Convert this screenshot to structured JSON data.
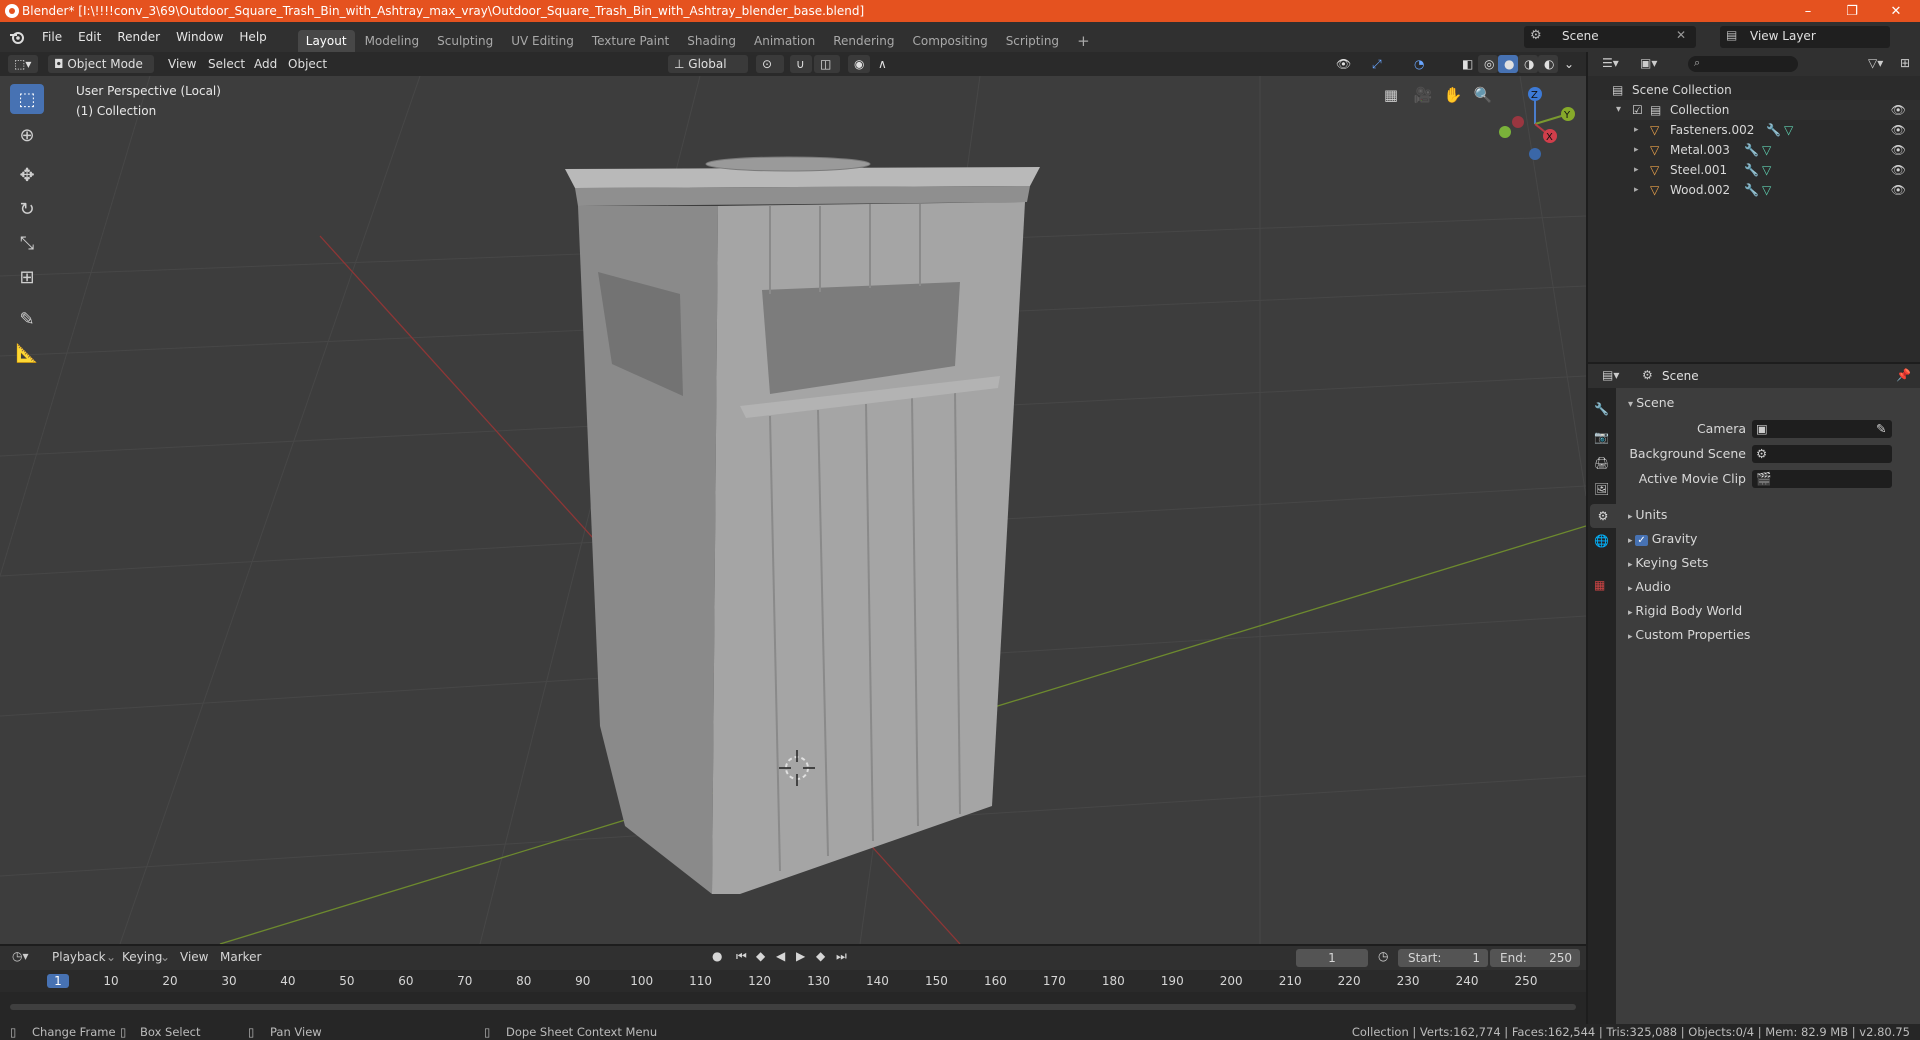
{
  "window": {
    "title": "Blender* [I:\\!!!!conv_3\\69\\Outdoor_Square_Trash_Bin_with_Ashtray_max_vray\\Outdoor_Square_Trash_Bin_with_Ashtray_blender_base.blend]",
    "minimize": "–",
    "maximize": "❐",
    "close": "✕",
    "accent": "#e5521f"
  },
  "menu": {
    "file": "File",
    "edit": "Edit",
    "render": "Render",
    "window": "Window",
    "help": "Help"
  },
  "workspaces": [
    "Layout",
    "Modeling",
    "Sculpting",
    "UV Editing",
    "Texture Paint",
    "Shading",
    "Animation",
    "Rendering",
    "Compositing",
    "Scripting"
  ],
  "workspace_add": "+",
  "scene_field": "Scene",
  "view_layer_field": "View Layer",
  "viewport_header": {
    "mode": "Object Mode",
    "view": "View",
    "select": "Select",
    "add": "Add",
    "object": "Object",
    "orientation": "Global"
  },
  "viewport": {
    "perspective": "User Perspective (Local)",
    "collection": "(1) Collection",
    "gizmo": {
      "x": "X",
      "y": "Y",
      "z": "Z"
    }
  },
  "outliner": {
    "root": "Scene Collection",
    "collection": "Collection",
    "objects": [
      "Fasteners.002",
      "Metal.003",
      "Steel.001",
      "Wood.002"
    ]
  },
  "properties": {
    "context": "Scene",
    "section": "Scene",
    "camera_label": "Camera",
    "background_label": "Background Scene",
    "movieclip_label": "Active Movie Clip",
    "panels": [
      "Units",
      "Gravity",
      "Keying Sets",
      "Audio",
      "Rigid Body World",
      "Custom Properties"
    ]
  },
  "timeline": {
    "playback": "Playback",
    "keying": "Keying",
    "view": "View",
    "marker": "Marker",
    "current_frame": "1",
    "start_label": "Start:",
    "start": "1",
    "end_label": "End:",
    "end": "250",
    "ticks": [
      "1",
      "10",
      "20",
      "30",
      "40",
      "50",
      "60",
      "70",
      "80",
      "90",
      "100",
      "110",
      "120",
      "130",
      "140",
      "150",
      "160",
      "170",
      "180",
      "190",
      "200",
      "210",
      "220",
      "230",
      "240",
      "250"
    ]
  },
  "statusbar": {
    "change_frame": "Change Frame",
    "box_select": "Box Select",
    "pan_view": "Pan View",
    "context_menu": "Dope Sheet Context Menu",
    "stats": "Collection | Verts:162,774 | Faces:162,544 | Tris:325,088 | Objects:0/4 | Mem: 82.9 MB | v2.80.75"
  }
}
